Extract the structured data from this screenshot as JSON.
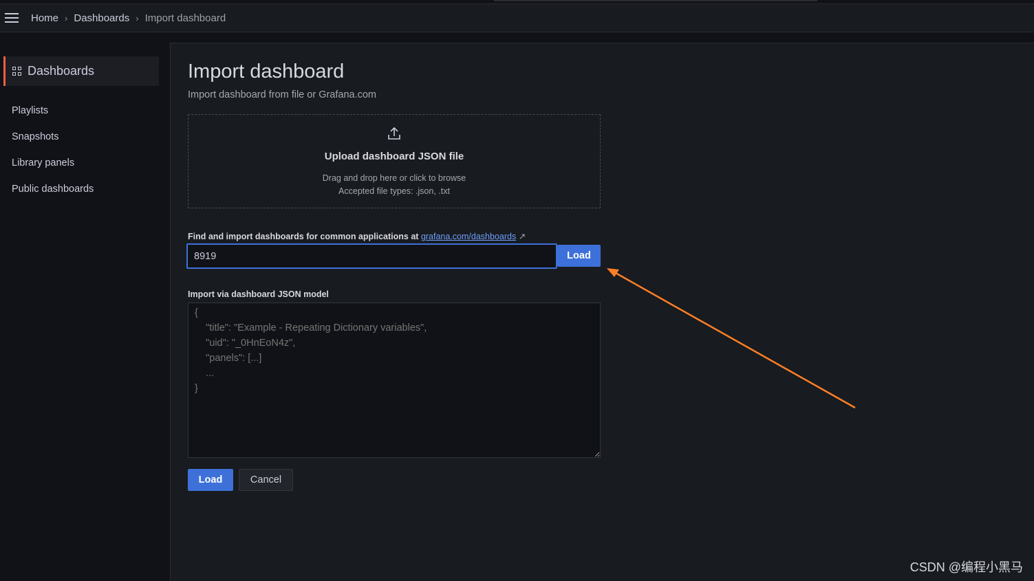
{
  "breadcrumb": {
    "items": [
      "Home",
      "Dashboards"
    ],
    "current": "Import dashboard"
  },
  "sidebar": {
    "active": "Dashboards",
    "items": [
      "Playlists",
      "Snapshots",
      "Library panels",
      "Public dashboards"
    ]
  },
  "page": {
    "title": "Import dashboard",
    "subtitle": "Import dashboard from file or Grafana.com"
  },
  "upload": {
    "title": "Upload dashboard JSON file",
    "hint": "Drag and drop here or click to browse",
    "types": "Accepted file types: .json, .txt"
  },
  "grafana": {
    "label": "Find and import dashboards for common applications at",
    "link": "grafana.com/dashboards",
    "value": "8919",
    "load": "Load"
  },
  "json": {
    "label": "Import via dashboard JSON model",
    "placeholder": "{\n    \"title\": \"Example - Repeating Dictionary variables\",\n    \"uid\": \"_0HnEoN4z\",\n    \"panels\": [...]\n    ...\n}"
  },
  "actions": {
    "load": "Load",
    "cancel": "Cancel"
  },
  "watermark": "CSDN @编程小黑马",
  "colors": {
    "accent": "#3d71d9",
    "annotation_arrow": "#ff7f27",
    "active_indicator": "#f55f3e"
  }
}
